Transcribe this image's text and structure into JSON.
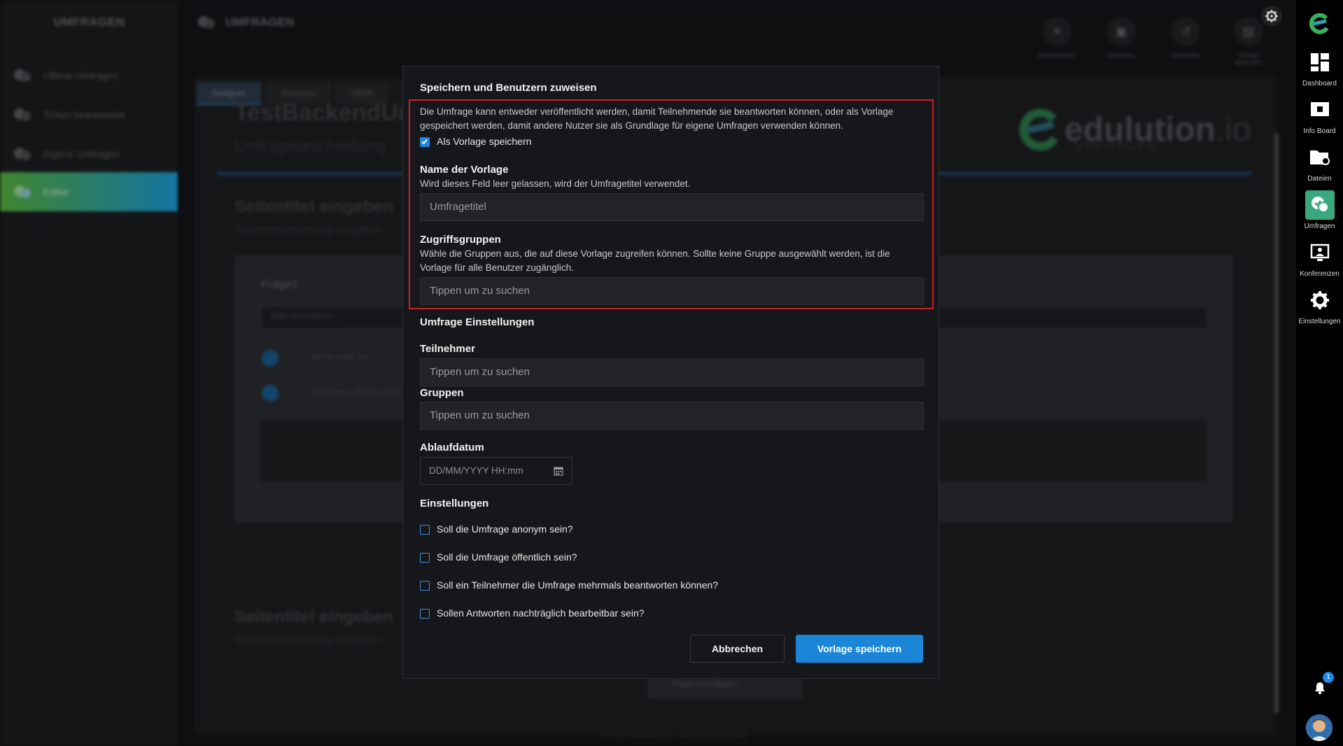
{
  "left_sidebar": {
    "title": "UMFRAGEN",
    "items": [
      {
        "label": "Offene Umfragen"
      },
      {
        "label": "Schon beantwortet"
      },
      {
        "label": "Eigene Umfragen"
      },
      {
        "label": "Editor"
      }
    ]
  },
  "header": {
    "title": "UMFRAGEN",
    "tools": [
      {
        "label": "Zurücksetzen",
        "icon": "close-icon"
      },
      {
        "label": "Speichern",
        "icon": "save-icon"
      },
      {
        "label": "Versenden",
        "icon": "undo-icon"
      },
      {
        "label": "Vorlage speichern",
        "icon": "file-icon"
      }
    ]
  },
  "background": {
    "tabs": [
      "Designer",
      "Vorschau",
      "JSON"
    ],
    "survey_title": "TestBackendUm",
    "survey_description": "Umfragebeschreibung",
    "page_title_1": "Seitentitel eingeben",
    "page_desc_1": "Seitenbeschreibung eingeben",
    "page_title_2": "Seitentitel eingeben",
    "page_desc_2": "Seitenbeschreibung eingeben",
    "question_title": "Frage1",
    "dropdown_placeholder": "Bitte auswählen...",
    "option_1": "Nicht mehr zu",
    "option_2": "Sonstiges (Bitte angeben)",
    "add_question": "Frage hinzufügen",
    "footer": "© 2024 edulution.io. All rights reserved."
  },
  "brand": {
    "name": "edulution",
    "suffix": ".io",
    "sub": "UMFRAGEN"
  },
  "right_sidebar": {
    "items": [
      {
        "label": "Dashboard"
      },
      {
        "label": "Info Board"
      },
      {
        "label": "Dateien"
      },
      {
        "label": "Umfragen"
      },
      {
        "label": "Konferenzen"
      },
      {
        "label": "Einstellungen"
      }
    ],
    "notification_count": "1"
  },
  "modal": {
    "title": "Speichern und Benutzern zuweisen",
    "intro": "Die Umfrage kann entweder veröffentlicht werden, damit Teilnehmende sie beantworten können, oder als Vorlage gespeichert werden, damit andere Nutzer sie als Grundlage für eigene Umfragen verwenden können.",
    "save_as_template_label": "Als Vorlage speichern",
    "template_name_label": "Name der Vorlage",
    "template_name_hint": "Wird dieses Feld leer gelassen, wird der Umfragetitel verwendet.",
    "template_name_placeholder": "Umfragetitel",
    "access_groups_label": "Zugriffsgruppen",
    "access_groups_hint": "Wähle die Gruppen aus, die auf diese Vorlage zugreifen können. Sollte keine Gruppe ausgewählt werden, ist die Vorlage für alle Benutzer zugänglich.",
    "access_groups_placeholder": "Tippen um zu suchen",
    "survey_settings_label": "Umfrage Einstellungen",
    "participants_label": "Teilnehmer",
    "participants_placeholder": "Tippen um zu suchen",
    "groups_label": "Gruppen",
    "groups_placeholder": "Tippen um zu suchen",
    "expiry_label": "Ablaufdatum",
    "expiry_placeholder": "DD/MM/YYYY HH:mm",
    "settings_label": "Einstellungen",
    "options": [
      {
        "label": "Soll die Umfrage anonym sein?",
        "checked": false
      },
      {
        "label": "Soll die Umfrage öffentlich sein?",
        "checked": false
      },
      {
        "label": "Soll ein Teilnehmer die Umfrage mehrmals beantworten können?",
        "checked": false
      },
      {
        "label": "Sollen Antworten nachträglich bearbeitbar sein?",
        "checked": false
      }
    ],
    "cancel_label": "Abbrechen",
    "save_label": "Vorlage speichern"
  },
  "colors": {
    "accent_blue": "#1b86d8",
    "highlight_red": "#c8202a",
    "active_green": "#3aa87f"
  }
}
